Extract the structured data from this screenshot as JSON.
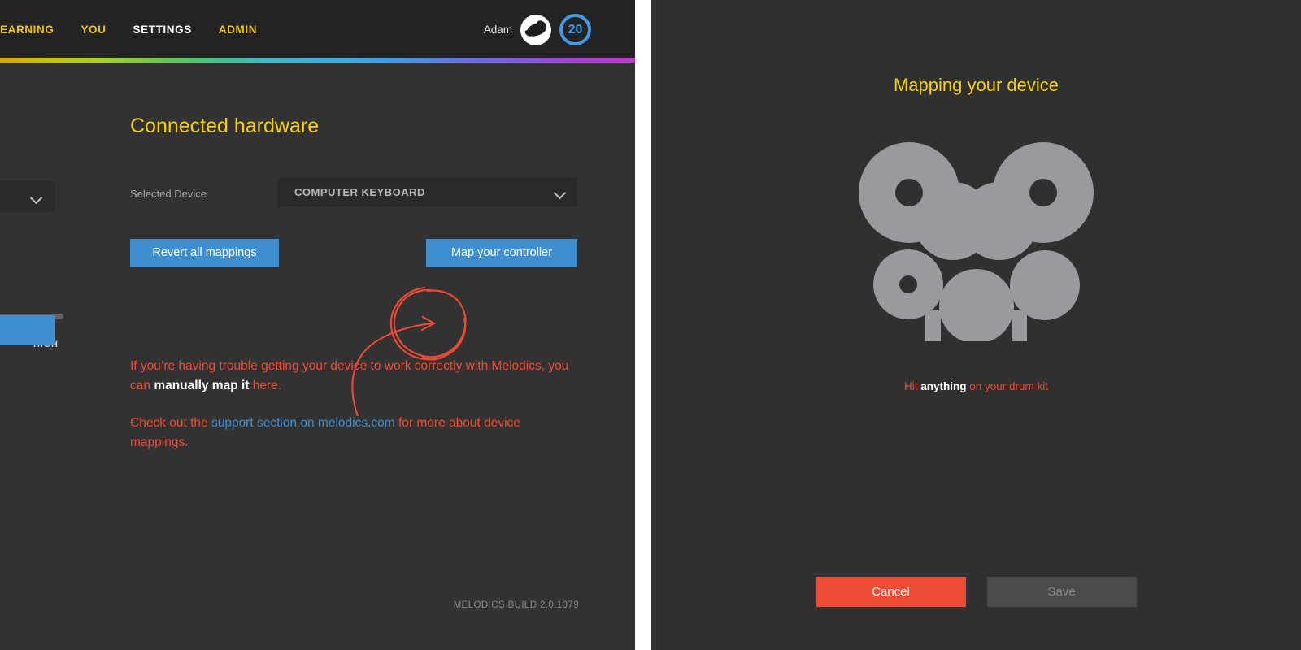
{
  "left_window": {
    "nav": {
      "items": [
        {
          "label": "EARNING",
          "active": false
        },
        {
          "label": "YOU",
          "active": false
        },
        {
          "label": "SETTINGS",
          "active": true
        },
        {
          "label": "ADMIN",
          "active": false
        }
      ]
    },
    "user": {
      "name": "Adam",
      "avatar_icon": "user-avatar-icon",
      "level": "20"
    },
    "page_title": "Connected hardware",
    "selected_device": {
      "label": "Selected Device",
      "value": "COMPUTER KEYBOARD",
      "chevron_icon": "chevron-down-icon"
    },
    "buttons": {
      "revert": "Revert all mappings",
      "map": "Map your controller"
    },
    "help": {
      "p1_a": "If you’re having trouble getting your device to work correctly with Melodics, you can ",
      "p1_bold": "manually map it",
      "p1_b": " here.",
      "p2_a": "Check out the ",
      "p2_link": "support section on melodics.com",
      "p2_b": " for more about device mappings."
    },
    "build": "MELODICS BUILD 2.0.1079",
    "background_fragment": {
      "high_label": "HIGH",
      "chevron_icon": "chevron-down-icon"
    },
    "annotation": {
      "name": "red-circle-arrow-annotation",
      "color": "#ef4a33"
    }
  },
  "right_window": {
    "title": "Mapping your device",
    "drumkit_icon": "drum-kit-icon",
    "hint_a": "Hit ",
    "hint_bold": "anything",
    "hint_b": " on your drum kit",
    "buttons": {
      "cancel": "Cancel",
      "save": "Save"
    }
  },
  "colors": {
    "accent_yellow": "#f7d000",
    "accent_blue": "#3d8fd1",
    "accent_red": "#ef4a33",
    "bg_dark": "#333233",
    "topbar": "#232323",
    "drum_gray": "#9a9a9e"
  }
}
